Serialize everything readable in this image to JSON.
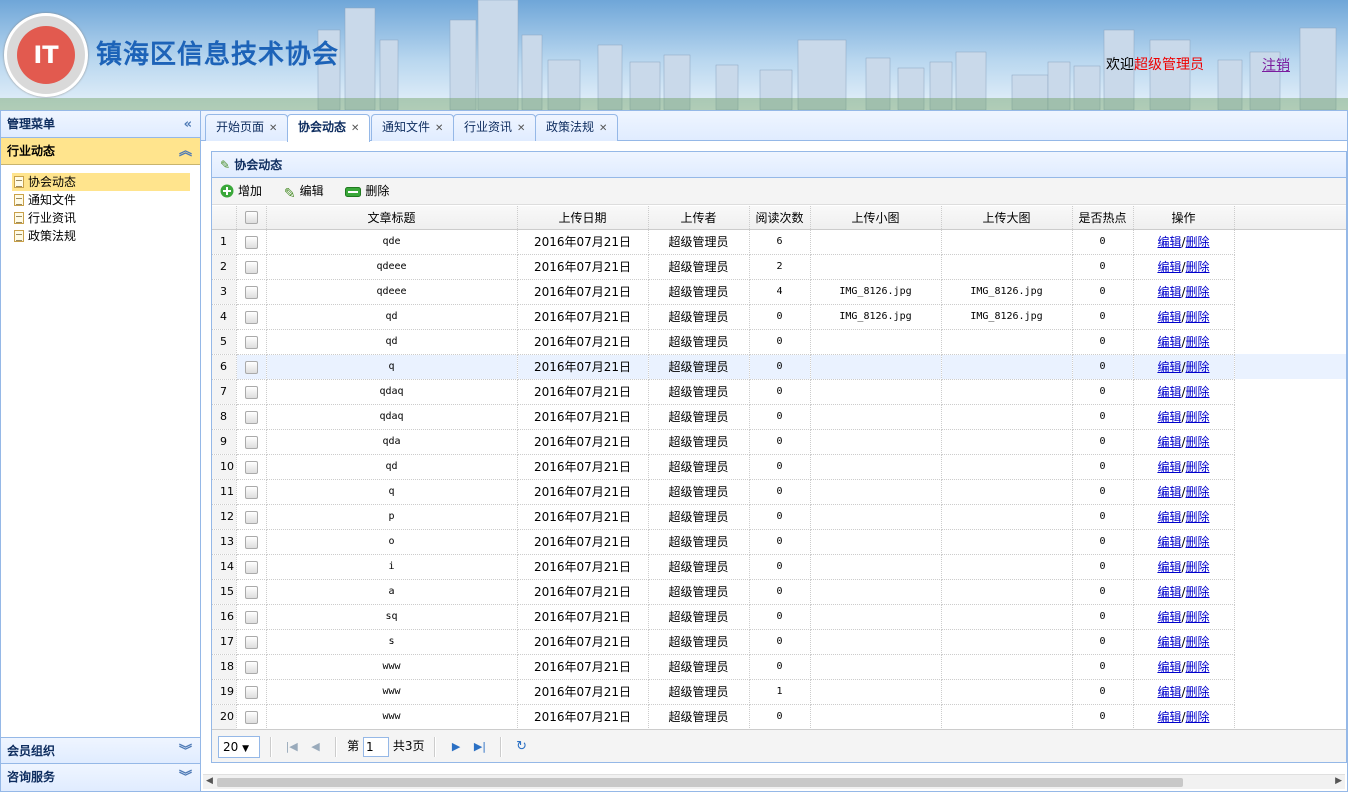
{
  "header": {
    "logo_text": "IT",
    "title": "镇海区信息技术协会",
    "welcome_prefix": "欢迎",
    "user": "超级管理员",
    "logout": "注销"
  },
  "sidebar": {
    "title": "管理菜单",
    "active_category": "行业动态",
    "items": [
      {
        "label": "协会动态"
      },
      {
        "label": "通知文件"
      },
      {
        "label": "行业资讯"
      },
      {
        "label": "政策法规"
      }
    ],
    "bottom": [
      "会员组织",
      "咨询服务"
    ]
  },
  "tabs": [
    {
      "label": "开始页面"
    },
    {
      "label": "协会动态"
    },
    {
      "label": "通知文件"
    },
    {
      "label": "行业资讯"
    },
    {
      "label": "政策法规"
    }
  ],
  "grid": {
    "title": "协会动态",
    "toolbar": {
      "add": "增加",
      "edit": "编辑",
      "delete": "删除"
    },
    "columns": [
      "文章标题",
      "上传日期",
      "上传者",
      "阅读次数",
      "上传小图",
      "上传大图",
      "是否热点",
      "操作"
    ],
    "op_edit": "编辑",
    "op_sep": "/",
    "op_delete": "删除",
    "rows": [
      {
        "n": "1",
        "title": "qde",
        "date": "2016年07月21日",
        "user": "超级管理员",
        "reads": "6",
        "small": "",
        "large": "",
        "hot": "0"
      },
      {
        "n": "2",
        "title": "qdeee",
        "date": "2016年07月21日",
        "user": "超级管理员",
        "reads": "2",
        "small": "",
        "large": "",
        "hot": "0"
      },
      {
        "n": "3",
        "title": "qdeee",
        "date": "2016年07月21日",
        "user": "超级管理员",
        "reads": "4",
        "small": "IMG_8126.jpg",
        "large": "IMG_8126.jpg",
        "hot": "0"
      },
      {
        "n": "4",
        "title": "qd",
        "date": "2016年07月21日",
        "user": "超级管理员",
        "reads": "0",
        "small": "IMG_8126.jpg",
        "large": "IMG_8126.jpg",
        "hot": "0"
      },
      {
        "n": "5",
        "title": "qd",
        "date": "2016年07月21日",
        "user": "超级管理员",
        "reads": "0",
        "small": "",
        "large": "",
        "hot": "0"
      },
      {
        "n": "6",
        "title": "q",
        "date": "2016年07月21日",
        "user": "超级管理员",
        "reads": "0",
        "small": "",
        "large": "",
        "hot": "0"
      },
      {
        "n": "7",
        "title": "qdaq",
        "date": "2016年07月21日",
        "user": "超级管理员",
        "reads": "0",
        "small": "",
        "large": "",
        "hot": "0"
      },
      {
        "n": "8",
        "title": "qdaq",
        "date": "2016年07月21日",
        "user": "超级管理员",
        "reads": "0",
        "small": "",
        "large": "",
        "hot": "0"
      },
      {
        "n": "9",
        "title": "qda",
        "date": "2016年07月21日",
        "user": "超级管理员",
        "reads": "0",
        "small": "",
        "large": "",
        "hot": "0"
      },
      {
        "n": "10",
        "title": "qd",
        "date": "2016年07月21日",
        "user": "超级管理员",
        "reads": "0",
        "small": "",
        "large": "",
        "hot": "0"
      },
      {
        "n": "11",
        "title": "q",
        "date": "2016年07月21日",
        "user": "超级管理员",
        "reads": "0",
        "small": "",
        "large": "",
        "hot": "0"
      },
      {
        "n": "12",
        "title": "p",
        "date": "2016年07月21日",
        "user": "超级管理员",
        "reads": "0",
        "small": "",
        "large": "",
        "hot": "0"
      },
      {
        "n": "13",
        "title": "o",
        "date": "2016年07月21日",
        "user": "超级管理员",
        "reads": "0",
        "small": "",
        "large": "",
        "hot": "0"
      },
      {
        "n": "14",
        "title": "i",
        "date": "2016年07月21日",
        "user": "超级管理员",
        "reads": "0",
        "small": "",
        "large": "",
        "hot": "0"
      },
      {
        "n": "15",
        "title": "a",
        "date": "2016年07月21日",
        "user": "超级管理员",
        "reads": "0",
        "small": "",
        "large": "",
        "hot": "0"
      },
      {
        "n": "16",
        "title": "sq",
        "date": "2016年07月21日",
        "user": "超级管理员",
        "reads": "0",
        "small": "",
        "large": "",
        "hot": "0"
      },
      {
        "n": "17",
        "title": "s",
        "date": "2016年07月21日",
        "user": "超级管理员",
        "reads": "0",
        "small": "",
        "large": "",
        "hot": "0"
      },
      {
        "n": "18",
        "title": "www",
        "date": "2016年07月21日",
        "user": "超级管理员",
        "reads": "0",
        "small": "",
        "large": "",
        "hot": "0"
      },
      {
        "n": "19",
        "title": "www",
        "date": "2016年07月21日",
        "user": "超级管理员",
        "reads": "1",
        "small": "",
        "large": "",
        "hot": "0"
      },
      {
        "n": "20",
        "title": "www",
        "date": "2016年07月21日",
        "user": "超级管理员",
        "reads": "0",
        "small": "",
        "large": "",
        "hot": "0"
      }
    ]
  },
  "pager": {
    "page_size": "20",
    "page_prefix": "第",
    "page": "1",
    "total": "共3页"
  },
  "colors": {
    "accent": "#95b8e7",
    "selected": "#ffe48d",
    "user_red": "#e00000",
    "link": "#0000cc"
  }
}
